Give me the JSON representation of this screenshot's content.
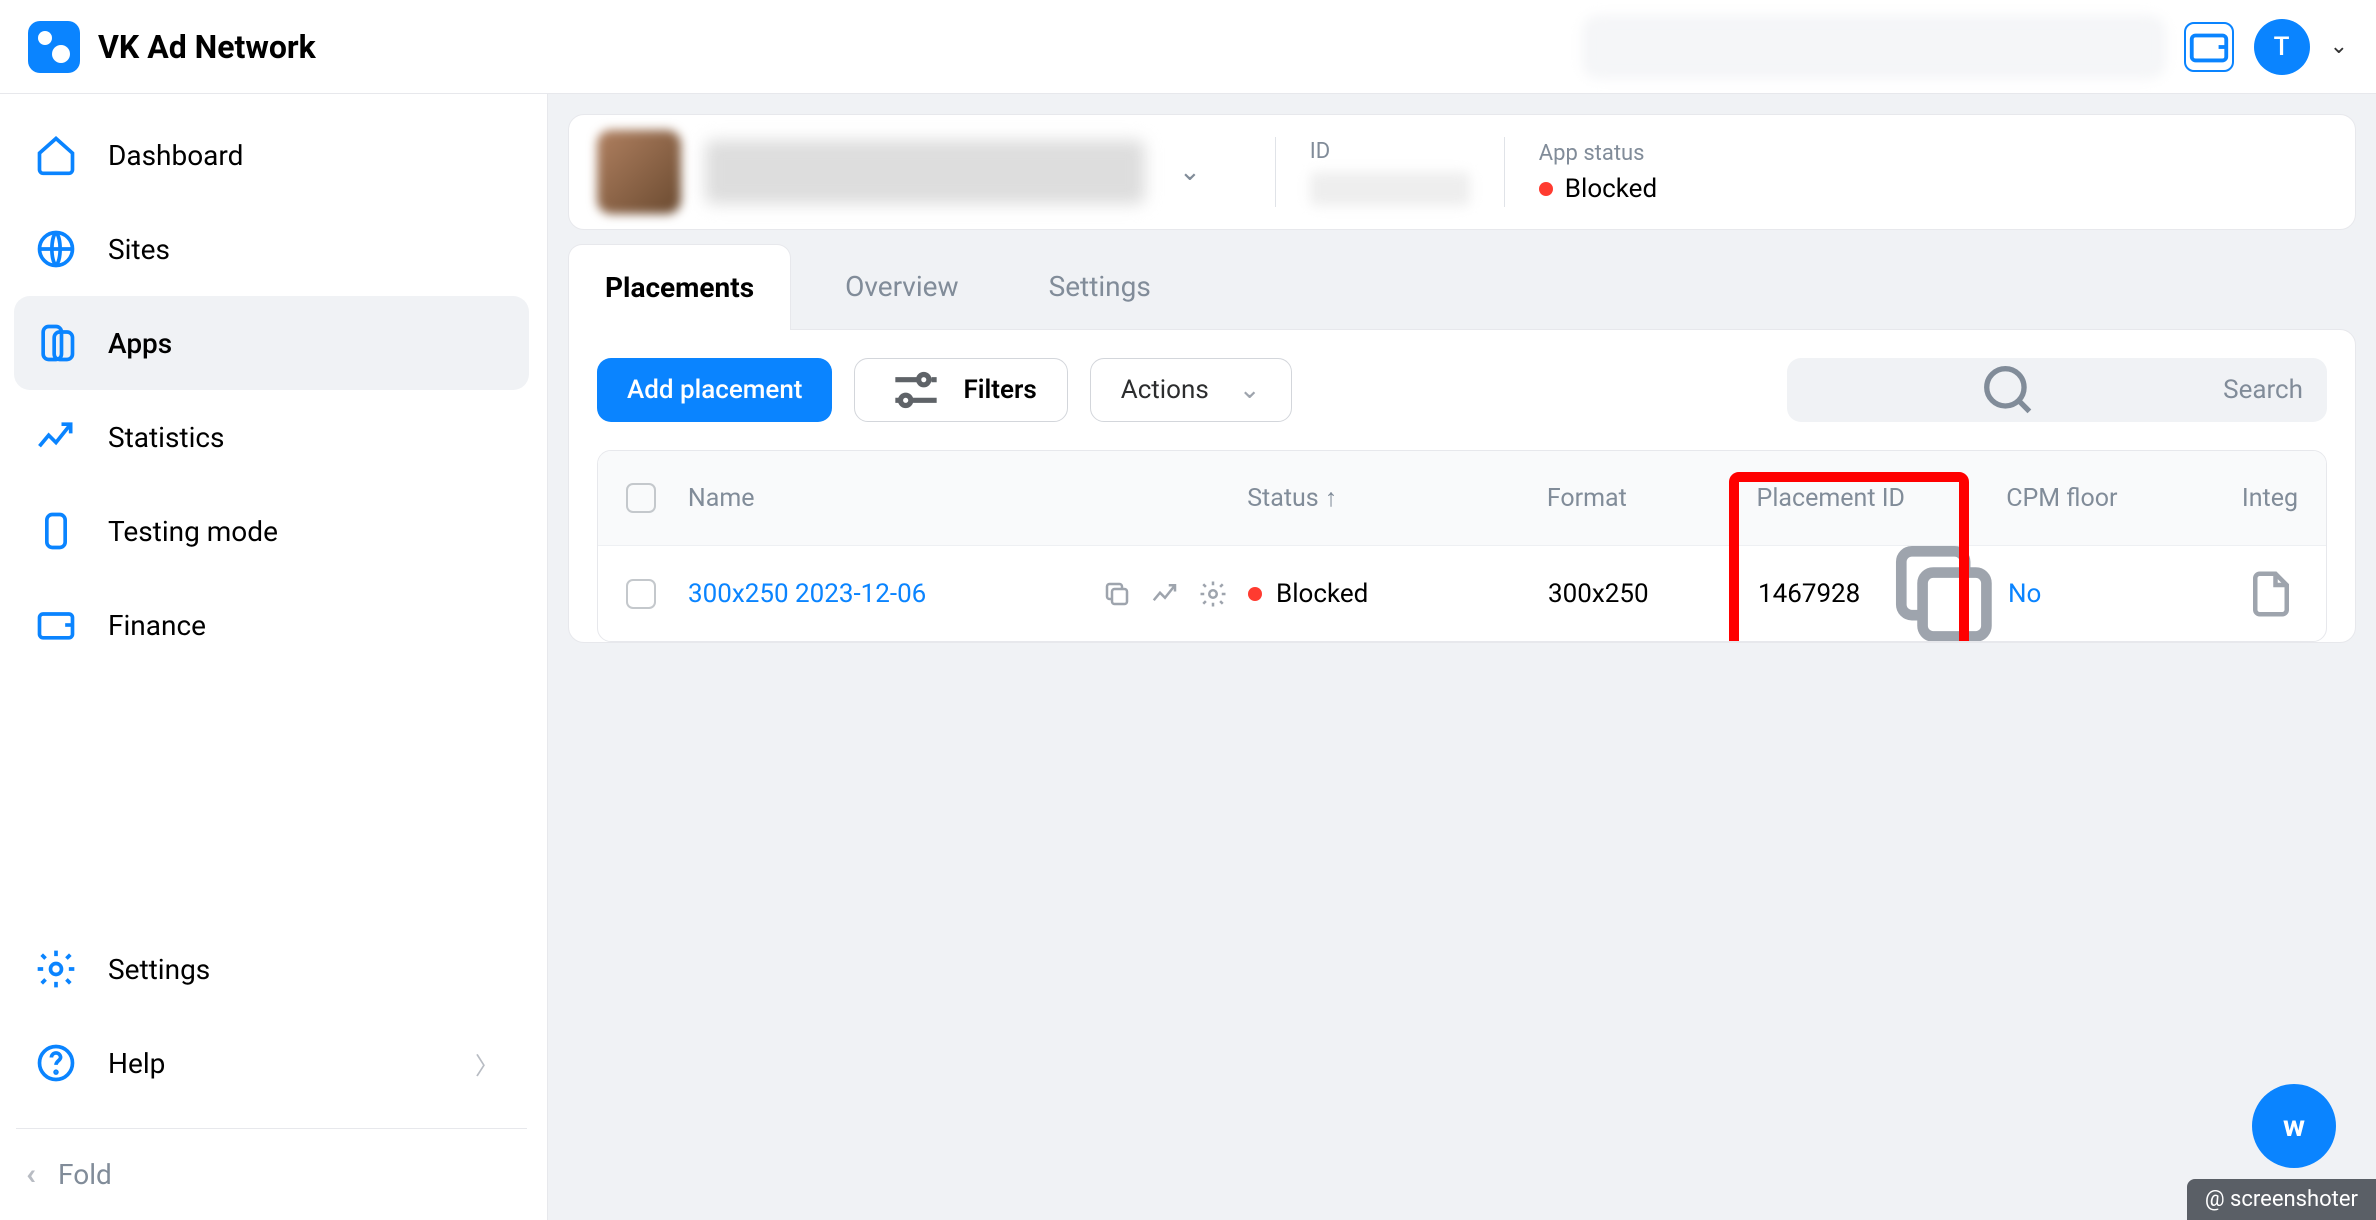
{
  "brand": {
    "title": "VK Ad Network"
  },
  "header": {
    "avatar_letter": "T"
  },
  "sidebar": {
    "items": [
      {
        "label": "Dashboard"
      },
      {
        "label": "Sites"
      },
      {
        "label": "Apps"
      },
      {
        "label": "Statistics"
      },
      {
        "label": "Testing mode"
      },
      {
        "label": "Finance"
      }
    ],
    "settings_label": "Settings",
    "help_label": "Help",
    "fold_label": "Fold"
  },
  "app_header": {
    "id_label": "ID",
    "status_label": "App status",
    "status_value": "Blocked"
  },
  "tabs": {
    "placements": "Placements",
    "overview": "Overview",
    "settings": "Settings"
  },
  "toolbar": {
    "add_label": "Add placement",
    "filters_label": "Filters",
    "actions_label": "Actions",
    "search_placeholder": "Search"
  },
  "table": {
    "columns": {
      "name": "Name",
      "status": "Status ↑",
      "format": "Format",
      "placement_id": "Placement ID",
      "cpm_floor": "CPM floor",
      "integ": "Integ"
    },
    "rows": [
      {
        "name": "300x250 2023-12-06",
        "status": "Blocked",
        "format": "300x250",
        "placement_id": "1467928",
        "cpm_floor": "No"
      }
    ]
  },
  "watermark": "@ screenshoter"
}
